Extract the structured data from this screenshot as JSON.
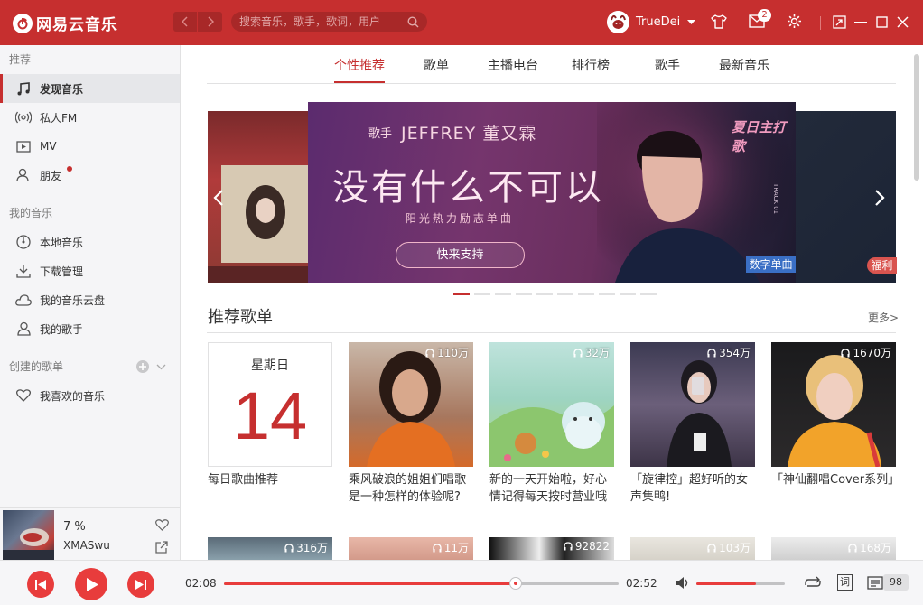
{
  "app": {
    "name": "网易云音乐",
    "accent": "#c62f2f"
  },
  "titlebar": {
    "search_placeholder": "搜索音乐，歌手，歌词，用户",
    "username": "TrueDei",
    "mail_badge": "2"
  },
  "sidebar": {
    "recommend_header": "推荐",
    "recommend_items": [
      "发现音乐",
      "私人FM",
      "MV",
      "朋友"
    ],
    "my_music_header": "我的音乐",
    "my_music_items": [
      "本地音乐",
      "下载管理",
      "我的音乐云盘",
      "我的歌手"
    ],
    "created_header": "创建的歌单",
    "created_items": [
      "我喜欢的音乐"
    ]
  },
  "now_playing": {
    "progress_text": "7 %",
    "title": "XMASwu"
  },
  "tabs": [
    "个性推荐",
    "歌单",
    "主播电台",
    "排行榜",
    "歌手",
    "最新音乐"
  ],
  "banner": {
    "singer_prefix": "歌手",
    "singer_name": "JEFFREY 董又霖",
    "headline": "没有什么不可以",
    "subline": "阳光热力励志单曲",
    "button": "快来支持",
    "tag": "数字单曲",
    "brand": "夏日主打歌",
    "track_label": "TRACK 01",
    "right_tag": "福利",
    "page_count": 10,
    "active_page": 0
  },
  "section": {
    "title": "推荐歌单",
    "more": "更多>"
  },
  "daily": {
    "weekday": "星期日",
    "day": "14",
    "caption": "每日歌曲推荐"
  },
  "playlists": [
    {
      "plays": "110万",
      "caption": "乘风破浪的姐姐们唱歌是一种怎样的体验呢?"
    },
    {
      "plays": "32万",
      "caption": "新的一天开始啦，好心情记得每天按时营业哦"
    },
    {
      "plays": "354万",
      "caption": "「旋律控」超好听的女声集鸭!"
    },
    {
      "plays": "1670万",
      "caption": "「神仙翻唱Cover系列」"
    }
  ],
  "row2_plays": [
    "316万",
    "11万",
    "92822",
    "103万",
    "168万"
  ],
  "player": {
    "elapsed": "02:08",
    "duration": "02:52",
    "progress": 0.74,
    "volume": 0.67,
    "lyrics_label": "词",
    "playlist_count": "98"
  }
}
